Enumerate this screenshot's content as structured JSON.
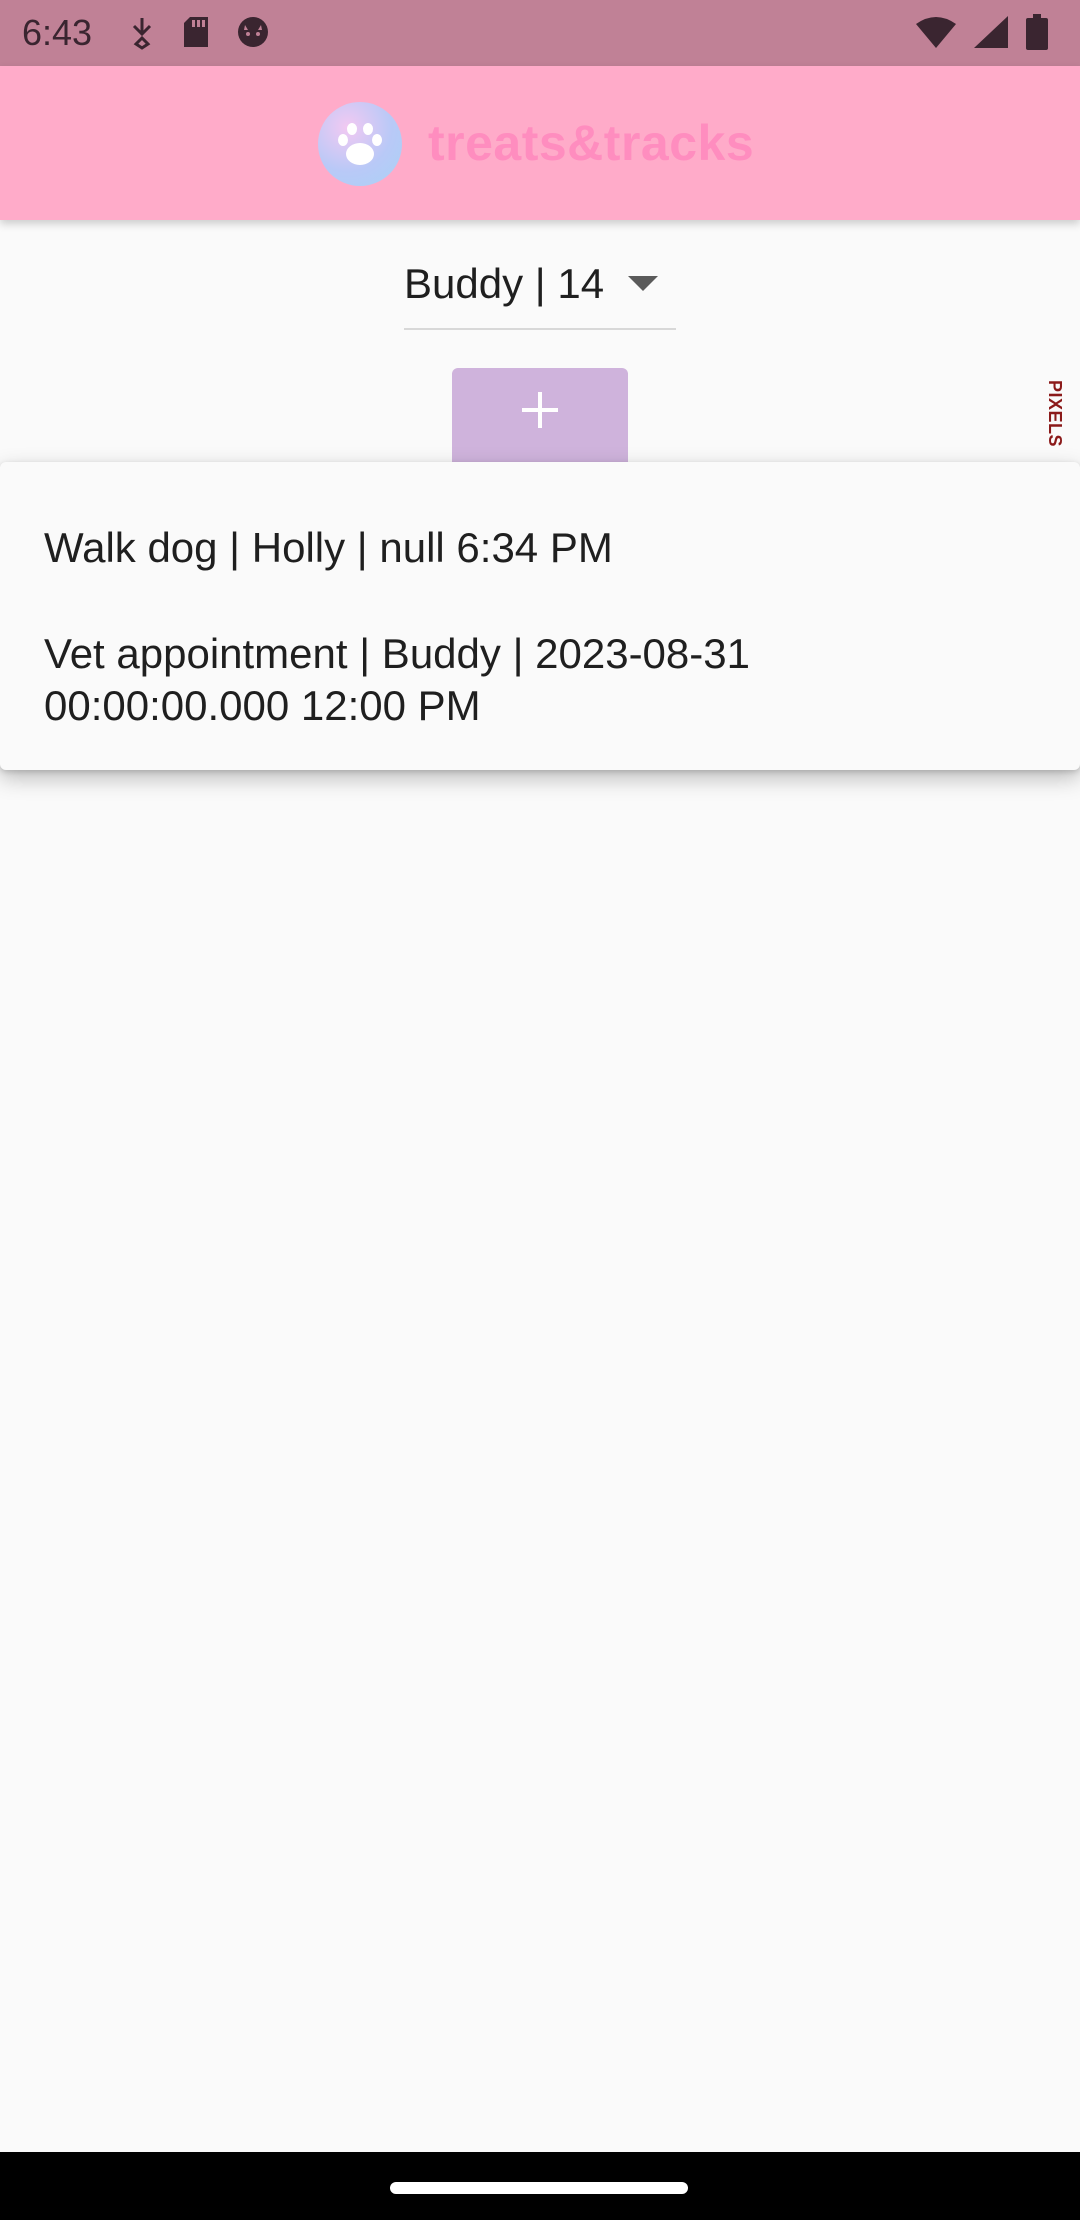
{
  "status_bar": {
    "time": "6:43",
    "left_icons": [
      "usb-debug-icon",
      "sd-card-icon",
      "cat-face-icon"
    ],
    "right_icons": [
      "wifi-icon",
      "signal-icon",
      "battery-icon"
    ]
  },
  "app_bar": {
    "title": "treats&tracks",
    "logo_icon": "paw-icon",
    "title_color": "#ff8dbf",
    "background": "#ffabc9"
  },
  "pet_selector": {
    "selected": "Buddy | 14",
    "arrow_icon": "dropdown-arrow-icon"
  },
  "add_button": {
    "icon": "plus-icon",
    "color": "#cfb3dc"
  },
  "debug_banner": {
    "text": "PIXELS"
  },
  "popup": {
    "items": [
      {
        "label": "Walk dog | Holly | null 6:34 PM"
      },
      {
        "line1": "Vet appointment | Buddy | 2023-08-31",
        "line2": "00:00:00.000 12:00 PM"
      }
    ]
  }
}
